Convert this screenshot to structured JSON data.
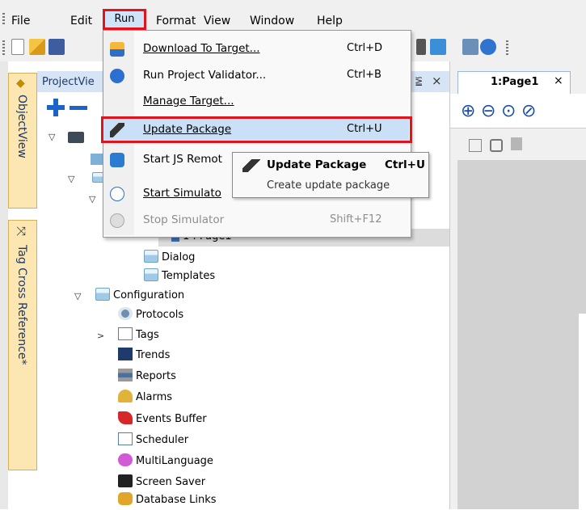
{
  "menubar": {
    "items": [
      "File",
      "Edit",
      "Run",
      "Format",
      "View",
      "Window",
      "Help"
    ]
  },
  "side_tabs": [
    "ObjectView",
    "Tag Cross Reference*"
  ],
  "project_view": {
    "title": "ProjectVie",
    "pin_glyph": "⪠",
    "close_glyph": "×",
    "tree": [
      {
        "label": "1 : Page1"
      },
      {
        "label": "Dialog"
      },
      {
        "label": "Templates"
      },
      {
        "label": "Configuration"
      },
      {
        "label": "Protocols"
      },
      {
        "label": "Tags"
      },
      {
        "label": "Trends"
      },
      {
        "label": "Reports"
      },
      {
        "label": "Alarms"
      },
      {
        "label": "Events Buffer"
      },
      {
        "label": "Scheduler"
      },
      {
        "label": "MultiLanguage"
      },
      {
        "label": "Screen Saver"
      },
      {
        "label": "Database Links"
      }
    ]
  },
  "page_tab": {
    "label": "1:Page1",
    "close": "×"
  },
  "run_menu": {
    "items": [
      {
        "label": "Download To Target...",
        "shortcut": "Ctrl+D",
        "enabled": true
      },
      {
        "label": "Run Project Validator...",
        "shortcut": "Ctrl+B",
        "enabled": true
      },
      {
        "label": "Manage Target...",
        "shortcut": "",
        "enabled": true
      },
      {
        "label": "Update Package",
        "shortcut": "Ctrl+U",
        "enabled": true,
        "highlighted": true
      },
      {
        "label": "Start JS Remot",
        "shortcut": "",
        "enabled": true
      },
      {
        "label": "Start Simulato",
        "shortcut": "",
        "enabled": true
      },
      {
        "label": "Stop Simulator",
        "shortcut": "Shift+F12",
        "enabled": false
      }
    ]
  },
  "tooltip": {
    "title": "Update Package",
    "shortcut": "Ctrl+U",
    "description": "Create update package"
  },
  "colors": {
    "highlight_border": "#e0141c",
    "menu_hover": "#c9e0f6",
    "accent_blue": "#1a64c8"
  }
}
